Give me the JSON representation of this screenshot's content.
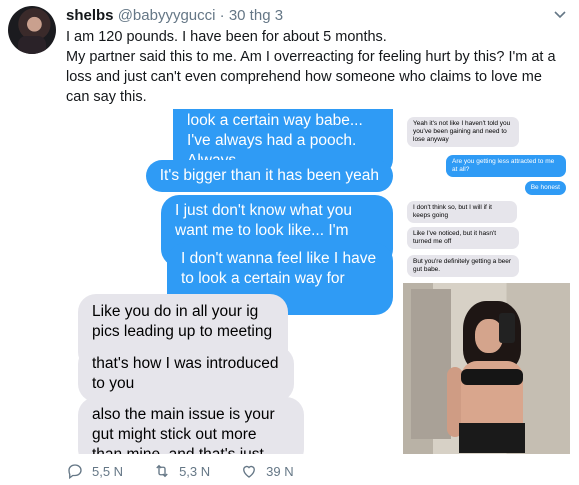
{
  "tweet": {
    "name": "shelbs",
    "handle": "@babyyygucci",
    "separator": "·",
    "date": "30 thg 3",
    "text_lines": [
      "I am 120 pounds. I have been for about 5 months.",
      "My partner said this to me. Am I overreacting for feeling hurt by this? I'm at a loss and just can't even comprehend how someone who claims to love me can say this."
    ]
  },
  "left_screenshot": {
    "outgoing": [
      "look a certain way babe... I've always had a pooch. Always",
      "It's bigger than it has been yeah",
      "I just don't know what you want me to look like... I'm worried",
      "I don't wanna feel like I have to look a certain way for you..."
    ],
    "incoming": [
      "Like you do in all your ig pics leading up to meeting you",
      "that's how I was introduced to you",
      "also the main issue is your gut might stick out more than mine, and that's just weird"
    ]
  },
  "right_screenshot": {
    "messages": [
      {
        "side": "in",
        "text": "Yeah it's not like I haven't told you you've been gaining and need to lose anyway"
      },
      {
        "side": "out",
        "text": "Are you getting less attracted to me at all?"
      },
      {
        "side": "out",
        "text": "Be honest"
      },
      {
        "side": "in",
        "text": "I don't think so, but I will if it keeps going"
      },
      {
        "side": "in",
        "text": "Like I've noticed, but it hasn't turned me off"
      },
      {
        "side": "in",
        "text": "But you're definitely getting a beer gut babe."
      }
    ]
  },
  "actions": {
    "replies": "5,5 N",
    "retweets": "5,3 N",
    "likes": "39 N"
  },
  "colors": {
    "imessage_blue": "#2f9bf5",
    "incoming_gray": "#e6e5eb",
    "meta_gray": "#657786"
  },
  "icons": [
    "caret-down-icon",
    "reply-icon",
    "retweet-icon",
    "like-icon"
  ]
}
